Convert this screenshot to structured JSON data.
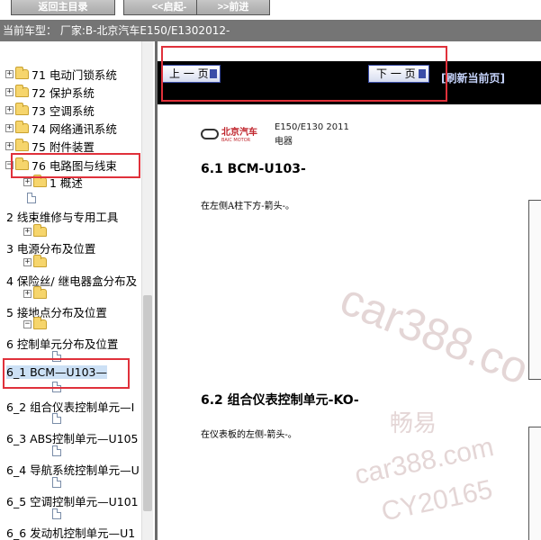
{
  "toolbar": {
    "home_label": "返回主目录",
    "start_label": "<<启起-",
    "next_label": ">>前进"
  },
  "vehicle_info": "当前车型： 厂家:B-北京汽车E150/E1302012-",
  "tree": {
    "items": [
      {
        "label": "71 电动门锁系统",
        "type": "folder"
      },
      {
        "label": "72 保护系统",
        "type": "folder"
      },
      {
        "label": "73 空调系统",
        "type": "folder"
      },
      {
        "label": "74 网络通讯系统",
        "type": "folder"
      },
      {
        "label": "75 附件装置",
        "type": "folder"
      },
      {
        "label": "76 电路图与线束",
        "type": "folder-open"
      },
      {
        "label": "1 概述",
        "type": "folder"
      }
    ],
    "links": [
      "2 线束维修与专用工具",
      "3 电源分布及位置",
      "4 保险丝/ 继电器盒分布及",
      "5 接地点分布及位置",
      "6 控制单元分布及位置",
      "6_1 BCM—U103—",
      "6_2 组合仪表控制单元—I",
      "6_3 ABS控制单元—U105",
      "6_4 导航系统控制单元—U",
      "6_5 空调控制单元—U101",
      "6_6 发动机控制单元—U1"
    ]
  },
  "nav": {
    "prev_label": "上 一 页",
    "next_label": "下 一 页",
    "refresh_label": "[刷新当前页]"
  },
  "doc": {
    "brand_cn": "北京汽车",
    "brand_en": "BAIC MOTOR",
    "model": "E150/E130 2011",
    "model_sub": "电器",
    "section1_title": "6.1 BCM-U103-",
    "section1_text": "在左侧A柱下方-箭头-。",
    "section2_title": "6.2 组合仪表控制单元-KO-",
    "section2_text": "在仪表板的左侧-箭头-。"
  },
  "watermark": {
    "line1": "car388.co",
    "line2": "畅易",
    "line3": "car388.com",
    "line4": "CY20165"
  },
  "colors": {
    "info_bar": "#757575",
    "highlight": "#e0313b",
    "brand_red": "#c0262d"
  }
}
